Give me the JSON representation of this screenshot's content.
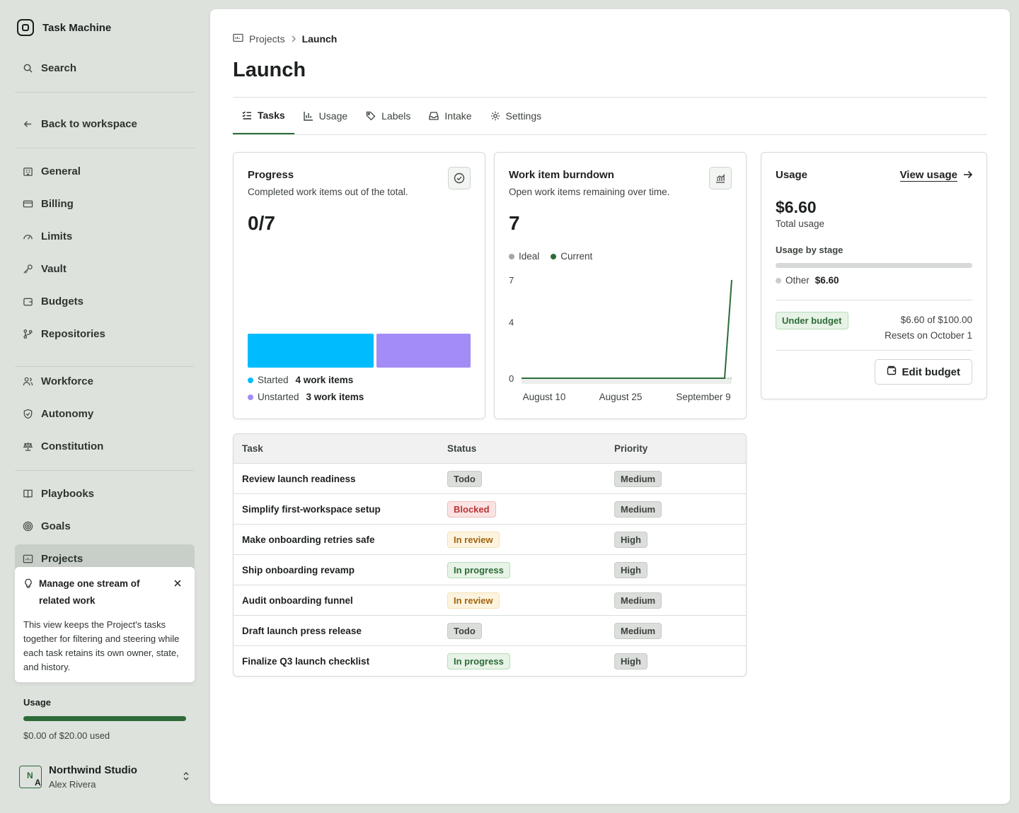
{
  "app": {
    "name": "Task Machine"
  },
  "sidebar": {
    "search_label": "Search",
    "back_label": "Back to workspace",
    "items": [
      {
        "label": "General",
        "icon": "building-icon"
      },
      {
        "label": "Billing",
        "icon": "card-icon"
      },
      {
        "label": "Limits",
        "icon": "gauge-icon"
      },
      {
        "label": "Vault",
        "icon": "key-icon"
      },
      {
        "label": "Budgets",
        "icon": "wallet-icon"
      },
      {
        "label": "Repositories",
        "icon": "branch-icon"
      },
      {
        "label": "Workforce",
        "icon": "people-icon"
      },
      {
        "label": "Autonomy",
        "icon": "shield-icon"
      },
      {
        "label": "Constitution",
        "icon": "scale-icon"
      },
      {
        "label": "Playbooks",
        "icon": "book-icon"
      },
      {
        "label": "Goals",
        "icon": "target-icon"
      },
      {
        "label": "Projects",
        "icon": "folder-icon"
      }
    ],
    "active_item": "Projects",
    "tip": {
      "title": "Manage one stream of related work",
      "body": "This view keeps the Project's tasks together for filtering and steering while each task retains its own owner, state, and history."
    },
    "usage": {
      "label": "Usage",
      "text": "$0.00 of $20.00 used",
      "fraction": 1.0
    },
    "account": {
      "org": "Northwind Studio",
      "user": "Alex Rivera",
      "initials_top": "N",
      "initials_bottom": "A"
    }
  },
  "breadcrumb": {
    "parent": "Projects",
    "current": "Launch"
  },
  "page": {
    "title": "Launch"
  },
  "tabs": [
    {
      "label": "Tasks",
      "icon": "checklist-icon",
      "active": true
    },
    {
      "label": "Usage",
      "icon": "bar-chart-icon",
      "active": false
    },
    {
      "label": "Labels",
      "icon": "tag-icon",
      "active": false
    },
    {
      "label": "Intake",
      "icon": "inbox-icon",
      "active": false
    },
    {
      "label": "Settings",
      "icon": "gear-icon",
      "active": false
    }
  ],
  "progress": {
    "title": "Progress",
    "subtitle": "Completed work items out of the total.",
    "value": "0/7",
    "legend": [
      {
        "label": "Started",
        "value": "4 work items",
        "count": 4,
        "color": "#00bcff"
      },
      {
        "label": "Unstarted",
        "value": "3 work items",
        "count": 3,
        "color": "#a38cf5"
      }
    ]
  },
  "burndown": {
    "title": "Work item burndown",
    "subtitle": "Open work items remaining over time.",
    "value": "7",
    "legend": [
      {
        "label": "Ideal",
        "color": "#a3a7a3"
      },
      {
        "label": "Current",
        "color": "#2e6b38"
      }
    ]
  },
  "chart_data": {
    "type": "line",
    "x_tick_labels": [
      "August 10",
      "August 25",
      "September 9"
    ],
    "y_ticks": [
      0,
      4,
      7
    ],
    "ylim": [
      0,
      7
    ],
    "series": [
      {
        "name": "Current",
        "values": [
          0,
          0,
          0,
          0,
          0,
          0,
          0,
          0,
          0,
          0,
          0,
          0,
          0,
          0,
          0,
          0,
          0,
          0,
          0,
          0,
          0,
          0,
          0,
          0,
          0,
          0,
          0,
          0,
          0,
          0,
          7
        ]
      },
      {
        "name": "Ideal",
        "values": [
          0,
          0
        ]
      }
    ],
    "grid": false,
    "legend": "top-left"
  },
  "usage": {
    "title": "Usage",
    "link_label": "View usage",
    "amount": "$6.60",
    "total_label": "Total usage",
    "stage_label": "Usage by stage",
    "stage_item": {
      "label": "Other",
      "value": "$6.60"
    },
    "badge": "Under budget",
    "budget_line": "$6.60 of $100.00",
    "reset_line": "Resets on October 1",
    "edit_label": "Edit budget"
  },
  "table": {
    "headers": [
      "Task",
      "Status",
      "Priority"
    ],
    "rows": [
      {
        "task": "Review launch readiness",
        "status": "Todo",
        "status_kind": "todo",
        "priority": "Medium"
      },
      {
        "task": "Simplify first-workspace setup",
        "status": "Blocked",
        "status_kind": "blocked",
        "priority": "Medium"
      },
      {
        "task": "Make onboarding retries safe",
        "status": "In review",
        "status_kind": "review",
        "priority": "High"
      },
      {
        "task": "Ship onboarding revamp",
        "status": "In progress",
        "status_kind": "progress",
        "priority": "High"
      },
      {
        "task": "Audit onboarding funnel",
        "status": "In review",
        "status_kind": "review",
        "priority": "Medium"
      },
      {
        "task": "Draft launch press release",
        "status": "Todo",
        "status_kind": "todo",
        "priority": "Medium"
      },
      {
        "task": "Finalize Q3 launch checklist",
        "status": "In progress",
        "status_kind": "progress",
        "priority": "High"
      }
    ]
  }
}
